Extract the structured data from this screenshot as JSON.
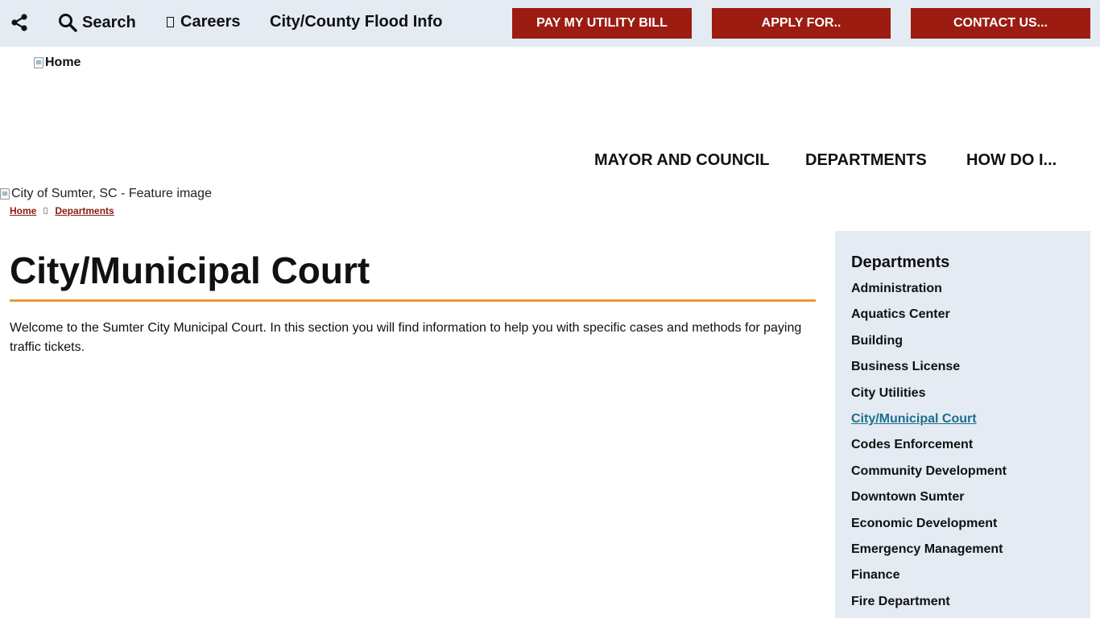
{
  "topbar": {
    "search_label": "Search",
    "careers_label": "Careers",
    "flood_label": "City/County Flood Info",
    "buttons": {
      "pay": "PAY MY UTILITY BILL",
      "apply": "APPLY FOR..",
      "contact": "CONTACT US..."
    }
  },
  "logo": {
    "alt": "Home"
  },
  "nav": {
    "mayor": "MAYOR AND COUNCIL",
    "departments": "DEPARTMENTS",
    "how": "HOW DO I..."
  },
  "feature": {
    "alt": "City of Sumter, SC - Feature image"
  },
  "breadcrumb": {
    "home": "Home",
    "departments": "Departments"
  },
  "page": {
    "title": "City/Municipal Court",
    "intro": "Welcome to the Sumter City Municipal Court. In this section you will find information to help you with specific cases and methods for paying traffic tickets."
  },
  "sidebar": {
    "heading": "Departments",
    "items": [
      "Administration",
      "Aquatics Center",
      "Building",
      "Business License",
      "City Utilities",
      "City/Municipal Court",
      "Codes Enforcement",
      "Community Development",
      "Downtown Sumter",
      "Economic Development",
      "Emergency Management",
      "Finance",
      "Fire Department"
    ],
    "active_index": 5
  },
  "colors": {
    "topbar_bg": "#e4ebf3",
    "button_bg": "#9c1c12",
    "accent_rule": "#e59a3e",
    "breadcrumb_link": "#8b1a10",
    "active_link": "#1d6f8c"
  },
  "icons": {
    "share": "share-icon",
    "search": "search-icon",
    "careers": "careers-icon"
  }
}
